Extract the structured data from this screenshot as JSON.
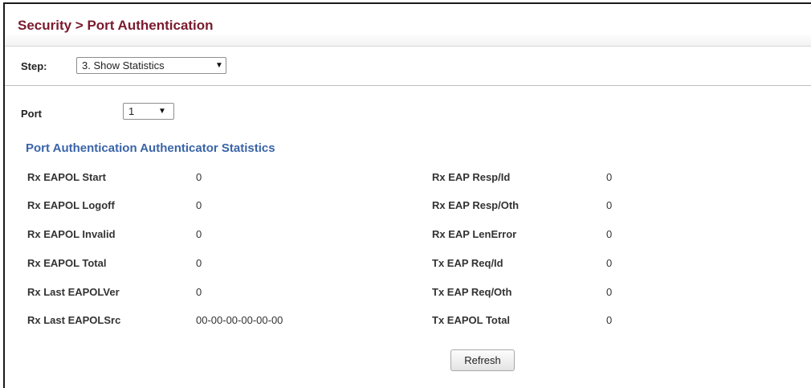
{
  "header": {
    "title": "Security > Port Authentication"
  },
  "step": {
    "label": "Step:",
    "selected": "3. Show Statistics"
  },
  "port": {
    "label": "Port",
    "selected": "1"
  },
  "section": {
    "title": "Port Authentication Authenticator Statistics"
  },
  "stats": {
    "left": [
      {
        "label": "Rx EAPOL Start",
        "value": "0"
      },
      {
        "label": "Rx EAPOL Logoff",
        "value": "0"
      },
      {
        "label": "Rx EAPOL Invalid",
        "value": "0"
      },
      {
        "label": "Rx EAPOL Total",
        "value": "0"
      },
      {
        "label": "Rx Last EAPOLVer",
        "value": "0"
      },
      {
        "label": "Rx Last EAPOLSrc",
        "value": "00-00-00-00-00-00"
      }
    ],
    "right": [
      {
        "label": "Rx EAP Resp/Id",
        "value": "0"
      },
      {
        "label": "Rx EAP Resp/Oth",
        "value": "0"
      },
      {
        "label": "Rx EAP LenError",
        "value": "0"
      },
      {
        "label": "Tx EAP Req/Id",
        "value": "0"
      },
      {
        "label": "Tx EAP Req/Oth",
        "value": "0"
      },
      {
        "label": "Tx EAPOL Total",
        "value": "0"
      }
    ]
  },
  "actions": {
    "refresh_label": "Refresh"
  },
  "colors": {
    "title": "#7a1a2c",
    "section_title": "#3a64a8"
  }
}
